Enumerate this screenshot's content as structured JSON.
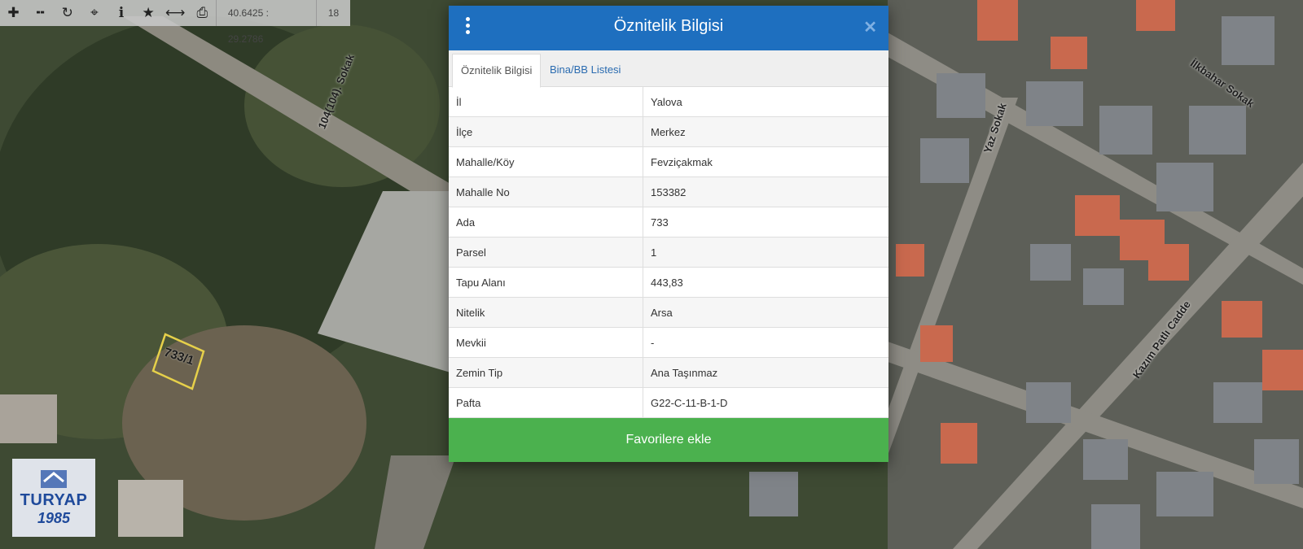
{
  "toolbar": {
    "icons": [
      "zoom-in-icon",
      "zoom-out-icon",
      "refresh-icon",
      "locate-icon",
      "info-icon",
      "favorites-icon",
      "measure-icon",
      "print-icon"
    ],
    "coordinates": "40.6425 : 29.2786",
    "zoom": "18"
  },
  "map": {
    "parcel_label": "733/1",
    "streets": [
      "104(104). Sokak",
      "İlkbahar Sokak",
      "Yaz Sokak",
      "Kazım Patlı Cadde"
    ]
  },
  "logo": {
    "word": "TURYAP",
    "year": "1985"
  },
  "modal": {
    "title": "Öznitelik Bilgisi",
    "tabs": [
      "Öznitelik Bilgisi",
      "Bina/BB Listesi"
    ],
    "rows": [
      {
        "key": "İl",
        "value": "Yalova"
      },
      {
        "key": "İlçe",
        "value": "Merkez"
      },
      {
        "key": "Mahalle/Köy",
        "value": "Fevziçakmak"
      },
      {
        "key": "Mahalle No",
        "value": "153382"
      },
      {
        "key": "Ada",
        "value": "733"
      },
      {
        "key": "Parsel",
        "value": "1"
      },
      {
        "key": "Tapu Alanı",
        "value": "443,83"
      },
      {
        "key": "Nitelik",
        "value": "Arsa"
      },
      {
        "key": "Mevkii",
        "value": "-"
      },
      {
        "key": "Zemin Tip",
        "value": "Ana Taşınmaz"
      },
      {
        "key": "Pafta",
        "value": "G22-C-11-B-1-D"
      }
    ],
    "button": "Favorilere ekle"
  },
  "colors": {
    "header": "#1e6fbf",
    "button": "#4bb14e",
    "tab_link": "#2a6bb0"
  }
}
